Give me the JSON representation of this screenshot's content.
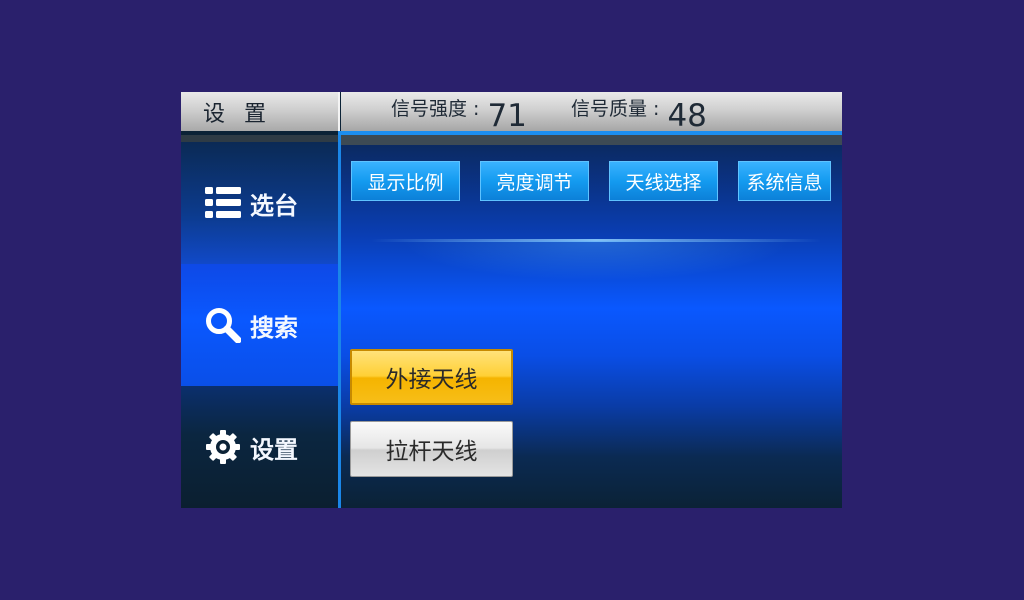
{
  "header": {
    "title": "设 置",
    "signal_strength_label": "信号强度 :",
    "signal_strength_value": "71",
    "signal_quality_label": "信号质量 :",
    "signal_quality_value": "48"
  },
  "sidebar": {
    "items": [
      {
        "label": "选台",
        "icon": "list-icon"
      },
      {
        "label": "搜索",
        "icon": "search-icon",
        "active": true
      },
      {
        "label": "设置",
        "icon": "gear-icon"
      }
    ]
  },
  "tabs": [
    {
      "label": "显示比例"
    },
    {
      "label": "亮度调节"
    },
    {
      "label": "天线选择"
    },
    {
      "label": "系统信息"
    }
  ],
  "antenna_options": {
    "external": "外接天线",
    "rod": "拉杆天线",
    "selected": "外接天线"
  },
  "colors": {
    "background": "#2a206c",
    "accent_blue": "#1c8ef0",
    "selected_yellow": "#ffd035"
  }
}
